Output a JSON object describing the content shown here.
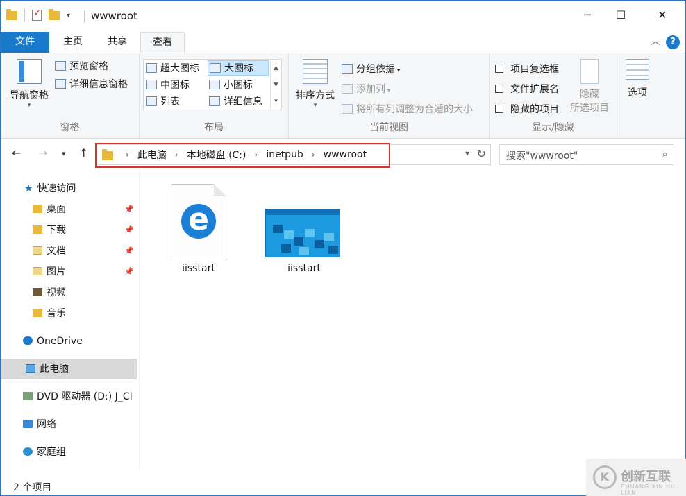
{
  "window": {
    "title": "wwwroot"
  },
  "ribbon_tabs": [
    "文件",
    "主页",
    "共享",
    "查看"
  ],
  "ribbon": {
    "panes": {
      "nav_pane": "导航窗格",
      "preview_pane": "预览窗格",
      "details_pane": "详细信息窗格",
      "label": "窗格"
    },
    "layout": {
      "extra_large": "超大图标",
      "large": "大图标",
      "medium": "中图标",
      "small": "小图标",
      "list": "列表",
      "details": "详细信息",
      "label": "布局",
      "selected": "大图标"
    },
    "current_view": {
      "sort_by": "排序方式",
      "group_by": "分组依据",
      "add_columns": "添加列",
      "size_columns": "将所有列调整为合适的大小",
      "label": "当前视图"
    },
    "show_hide": {
      "item_checkboxes": "项目复选框",
      "file_extensions": "文件扩展名",
      "hidden_items": "隐藏的项目",
      "hide_selected_line1": "隐藏",
      "hide_selected_line2": "所选项目",
      "label": "显示/隐藏"
    },
    "options": "选项"
  },
  "address": {
    "crumbs": [
      "此电脑",
      "本地磁盘 (C:)",
      "inetpub",
      "wwwroot"
    ]
  },
  "search": {
    "placeholder": "搜索\"wwwroot\""
  },
  "nav_pane": {
    "quick_access": "快速访问",
    "quick_items": [
      "桌面",
      "下载",
      "文档",
      "图片",
      "视频",
      "音乐"
    ],
    "onedrive": "OneDrive",
    "this_pc": "此电脑",
    "dvd": "DVD 驱动器 (D:) J_CI",
    "network": "网络",
    "homegroup": "家庭组"
  },
  "files": [
    {
      "name": "iisstart",
      "icon": "edge-html-icon"
    },
    {
      "name": "iisstart",
      "icon": "png-thumbnail"
    }
  ],
  "status": {
    "item_count": "2 个项目"
  },
  "watermark": {
    "cn": "创新互联",
    "en": "CHUANG XIN HU LIAN"
  },
  "colors": {
    "accent": "#1979ca",
    "highlight_box": "#d9322f",
    "selected_nav": "#d9d9d9"
  }
}
